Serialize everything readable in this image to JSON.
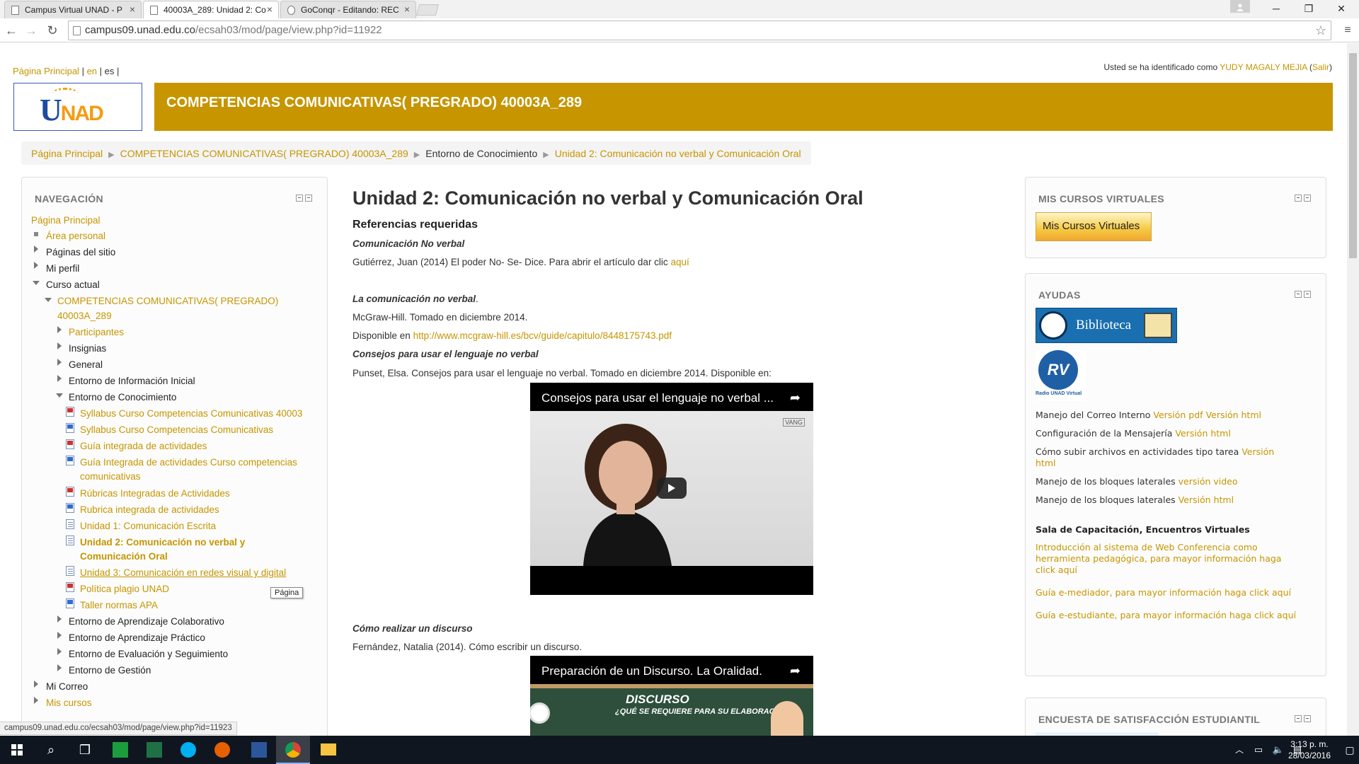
{
  "browser": {
    "tabs": [
      {
        "title": "Campus Virtual UNAD - P",
        "active": false
      },
      {
        "title": "40003A_289: Unidad 2: Co",
        "active": true
      },
      {
        "title": "GoConqr - Editando: REC",
        "active": false
      }
    ],
    "url_host": "campus09.unad.edu.co",
    "url_path": "/ecsah03/mod/page/view.php?id=11922",
    "status_url": "campus09.unad.edu.co/ecsah03/mod/page/view.php?id=11923"
  },
  "header": {
    "home_link": "Página Principal",
    "lang_en": "en",
    "lang_es": "es",
    "login_prefix": "Usted se ha identificado como",
    "user_name": "YUDY MAGALY MEJIA",
    "logout": "Salir",
    "logo_text": "UNAD",
    "course_title": "COMPETENCIAS COMUNICATIVAS( PREGRADO) 40003A_289"
  },
  "breadcrumb": [
    "Página Principal",
    "COMPETENCIAS COMUNICATIVAS( PREGRADO) 40003A_289",
    "Entorno de Conocimiento",
    "Unidad 2: Comunicación no verbal y Comunicación Oral"
  ],
  "nav": {
    "title": "NAVEGACIÓN",
    "items": [
      "Página Principal",
      "Área personal",
      "Páginas del sitio",
      "Mi perfil",
      "Curso actual",
      "COMPETENCIAS COMUNICATIVAS( PREGRADO)",
      "40003A_289",
      "Participantes",
      "Insignias",
      "General",
      "Entorno de Información Inicial",
      "Entorno de Conocimiento",
      "Syllabus Curso Competencias Comunicativas 40003",
      "Syllabus Curso Competencias Comunicativas",
      "Guía integrada de actividades",
      "Guía Integrada de actividades Curso competencias",
      "comunicativas",
      "Rúbricas Integradas de Actividades",
      "Rubrica integrada de actividades",
      "Unidad 1: Comunicación Escrita",
      "Unidad 2: Comunicación no verbal y",
      "Comunicación Oral",
      "Unidad 3: Comunicación en redes visual y digital",
      "Política plagio UNAD",
      "Taller normas APA",
      "Entorno de Aprendizaje Colaborativo",
      "Entorno de Aprendizaje Práctico",
      "Entorno de Evaluación y Seguimiento",
      "Entorno de Gestión",
      "Mi Correo",
      "Mis cursos"
    ],
    "tooltip": "Página"
  },
  "main": {
    "title": "Unidad 2: Comunicación no verbal y Comunicación Oral",
    "subtitle": "Referencias requeridas",
    "s1_title": "Comunicación No verbal",
    "s1_text": "Gutiérrez, Juan (2014) El poder No- Se- Dice. Para abrir el artículo dar clic",
    "s1_link": "aquí",
    "s2_title": "La comunicación no verbal",
    "s2_dot": ".",
    "s2_text1": "McGraw-Hill. Tomado en diciembre 2014.",
    "s2_text2": "Disponible en",
    "s2_link": "http://www.mcgraw-hill.es/bcv/guide/capitulo/8448175743.pdf",
    "s3_title": "Consejos para usar el lenguaje no verbal",
    "s3_text": "Punset, Elsa. Consejos para usar el lenguaje no verbal. Tomado en diciembre 2014. Disponible en:",
    "video1_title": "Consejos para usar el lenguaje no verbal ...",
    "video1_watermark": "VANG",
    "s4_title": "Cómo realizar un discurso",
    "s4_text": "Fernández, Natalia (2014). Cómo escribir un discurso.",
    "video2_title": "Preparación de un Discurso. La Oralidad.",
    "video2_board1": "DISCURSO",
    "video2_board2": "¿QUÉ SE REQUIERE PARA SU ELABORACIÓN?"
  },
  "right": {
    "block1_title": "MIS CURSOS VIRTUALES",
    "block1_button": "Mis Cursos Virtuales",
    "block2_title": "AYUDAS",
    "biblioteca": "Biblioteca",
    "radio_label": "Radio UNAD Virtual",
    "help": [
      {
        "text": "Manejo del Correo Interno ",
        "links": [
          "Versión pdf",
          "Versión html"
        ]
      },
      {
        "text": "Configuración de la Mensajería ",
        "links": [
          "Versión html"
        ]
      },
      {
        "text": "Cómo subir archivos en actividades tipo tarea ",
        "links": [
          "Versión"
        ]
      },
      {
        "text": "",
        "links": [
          "html"
        ]
      },
      {
        "text": "Manejo de los bloques laterales ",
        "links": [
          "versión video"
        ]
      },
      {
        "text": "Manejo de los bloques laterales ",
        "links": [
          "Versión html"
        ]
      }
    ],
    "sala_title": "Sala de Capacitación, Encuentros Virtuales",
    "sala_link1": [
      "Introducción al sistema de Web Conferencia como",
      "herramienta pedagógica, para mayor información haga",
      "click aquí"
    ],
    "sala_link2": "Guía e-mediador, para mayor información haga click aquí",
    "sala_link3": "Guía e-estudiante, para mayor información haga click aquí",
    "block3_title": "ENCUESTA DE SATISFACCIÓN ESTUDIANTIL"
  },
  "taskbar": {
    "time": "3:13 p. m.",
    "date": "28/03/2016"
  },
  "colors": {
    "accent": "#c69500",
    "taskbar": "#101620"
  }
}
